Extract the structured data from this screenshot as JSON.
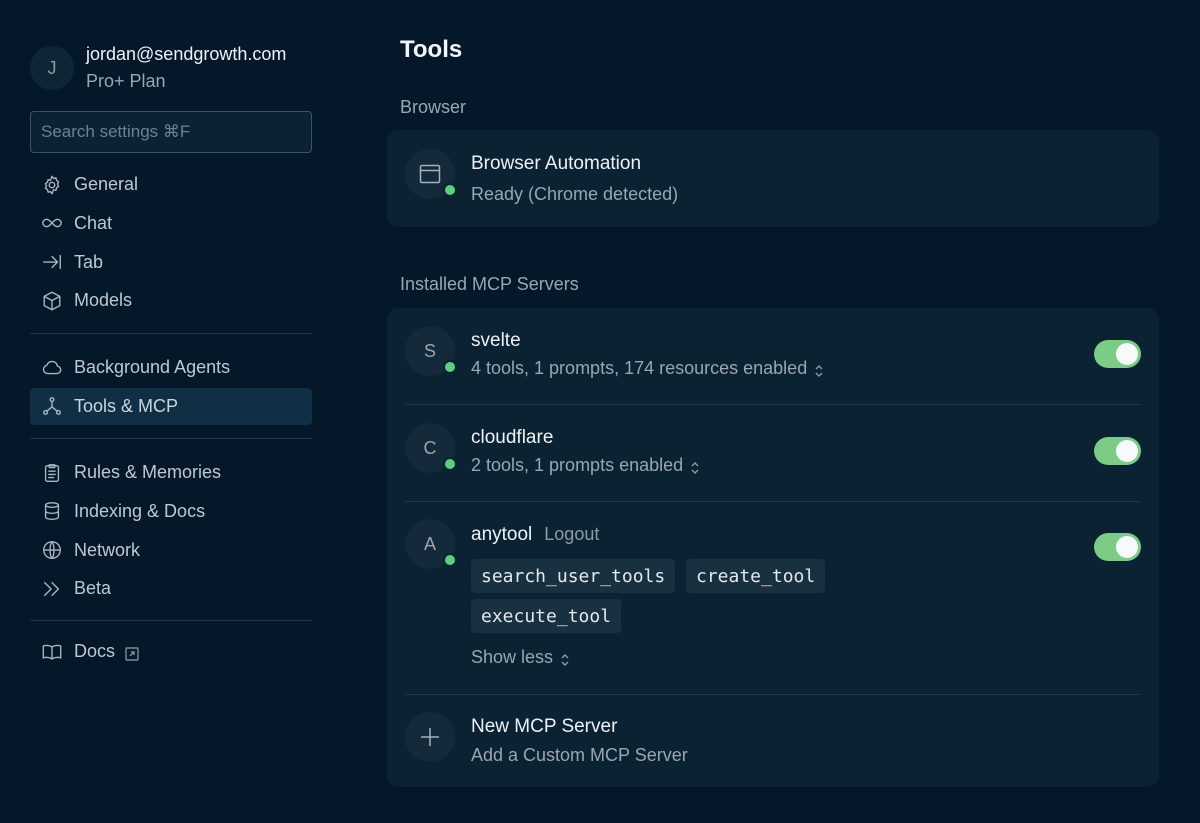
{
  "user": {
    "avatar_letter": "J",
    "email": "jordan@sendgrowth.com",
    "plan": "Pro+ Plan"
  },
  "search": {
    "placeholder": "Search settings ⌘F",
    "value": ""
  },
  "nav": {
    "group1": [
      {
        "label": "General",
        "icon": "gear-icon"
      },
      {
        "label": "Chat",
        "icon": "infinity-icon"
      },
      {
        "label": "Tab",
        "icon": "tab-arrow-icon"
      },
      {
        "label": "Models",
        "icon": "cube-icon"
      }
    ],
    "group2": [
      {
        "label": "Background Agents",
        "icon": "cloud-icon"
      },
      {
        "label": "Tools & MCP",
        "icon": "tools-network-icon",
        "active": true
      }
    ],
    "group3": [
      {
        "label": "Rules & Memories",
        "icon": "clipboard-icon"
      },
      {
        "label": "Indexing & Docs",
        "icon": "database-icon"
      },
      {
        "label": "Network",
        "icon": "globe-icon"
      },
      {
        "label": "Beta",
        "icon": "double-chevron-icon"
      }
    ],
    "group4": [
      {
        "label": "Docs",
        "icon": "book-icon",
        "external_icon": "external-link-icon"
      }
    ]
  },
  "main": {
    "title": "Tools",
    "browser_section": {
      "label": "Browser",
      "item": {
        "name": "Browser Automation",
        "status": "Ready (Chrome detected)",
        "icon": "browser-window-icon"
      }
    },
    "mcp_section": {
      "label": "Installed MCP Servers",
      "servers": [
        {
          "letter": "S",
          "name": "svelte",
          "summary": "4 tools, 1 prompts, 174 resources enabled",
          "enabled": true
        },
        {
          "letter": "C",
          "name": "cloudflare",
          "summary": "2 tools, 1 prompts enabled",
          "enabled": true
        },
        {
          "letter": "A",
          "name": "anytool",
          "action": "Logout",
          "enabled": true,
          "tools": [
            "search_user_tools",
            "create_tool",
            "execute_tool"
          ],
          "toggle_label": "Show less"
        }
      ],
      "new_server": {
        "title": "New MCP Server",
        "subtitle": "Add a Custom MCP Server",
        "icon": "plus-icon"
      }
    }
  },
  "colors": {
    "background": "#04182a",
    "card": "#0b2233",
    "toggle_on": "#7ccb86",
    "status_ok": "#5ecf80",
    "active_nav": "#102f45"
  }
}
